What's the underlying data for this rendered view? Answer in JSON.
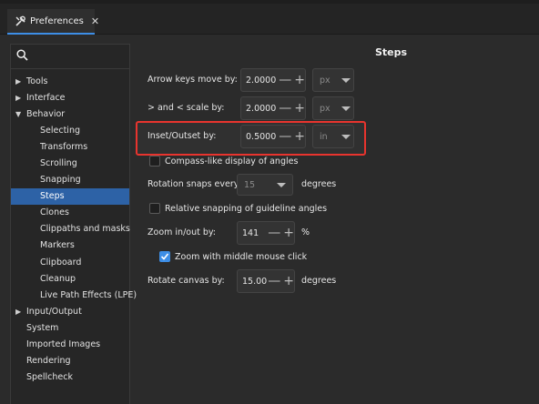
{
  "tab": {
    "title": "Preferences",
    "close": "✕",
    "icon": "tools-icon"
  },
  "search": {
    "icon": "search-icon",
    "placeholder": ""
  },
  "tree": [
    {
      "label": "Tools",
      "arrow": "▶",
      "level": 0
    },
    {
      "label": "Interface",
      "arrow": "▶",
      "level": 0
    },
    {
      "label": "Behavior",
      "arrow": "▼",
      "level": 0
    },
    {
      "label": "Selecting",
      "level": 1
    },
    {
      "label": "Transforms",
      "level": 1
    },
    {
      "label": "Scrolling",
      "level": 1
    },
    {
      "label": "Snapping",
      "level": 1
    },
    {
      "label": "Steps",
      "level": 1,
      "selected": true
    },
    {
      "label": "Clones",
      "level": 1
    },
    {
      "label": "Clippaths and masks",
      "level": 1
    },
    {
      "label": "Markers",
      "level": 1
    },
    {
      "label": "Clipboard",
      "level": 1
    },
    {
      "label": "Cleanup",
      "level": 1
    },
    {
      "label": "Live Path Effects (LPE)",
      "level": 1
    },
    {
      "label": "Input/Output",
      "arrow": "▶",
      "level": 0
    },
    {
      "label": "System",
      "level": 0
    },
    {
      "label": "Imported Images",
      "level": 0
    },
    {
      "label": "Rendering",
      "level": 0
    },
    {
      "label": "Spellcheck",
      "level": 0
    }
  ],
  "page": {
    "heading": "Steps",
    "arrow_keys": {
      "label": "Arrow keys move by:",
      "value": "2.0000",
      "unit": "px"
    },
    "scale": {
      "label": "> and < scale by:",
      "value": "2.0000",
      "unit": "px"
    },
    "inset": {
      "label": "Inset/Outset by:",
      "value": "0.5000",
      "unit": "in"
    },
    "compass": {
      "label": "Compass-like display of angles",
      "checked": false
    },
    "rotation": {
      "label": "Rotation snaps every:",
      "value": "15",
      "suffix": "degrees"
    },
    "relative": {
      "label": "Relative snapping of guideline angles",
      "checked": false
    },
    "zoom": {
      "label": "Zoom in/out by:",
      "value": "141",
      "suffix": "%"
    },
    "zoom_middle": {
      "label": "Zoom with middle mouse click",
      "checked": true
    },
    "rotate_canvas": {
      "label": "Rotate canvas by:",
      "value": "15.00",
      "suffix": "degrees"
    },
    "stepper_minus": "—",
    "stepper_plus": "+"
  },
  "colors": {
    "accent": "#3d8ee6",
    "selection": "#2d62a6",
    "highlight": "#e8342e"
  }
}
